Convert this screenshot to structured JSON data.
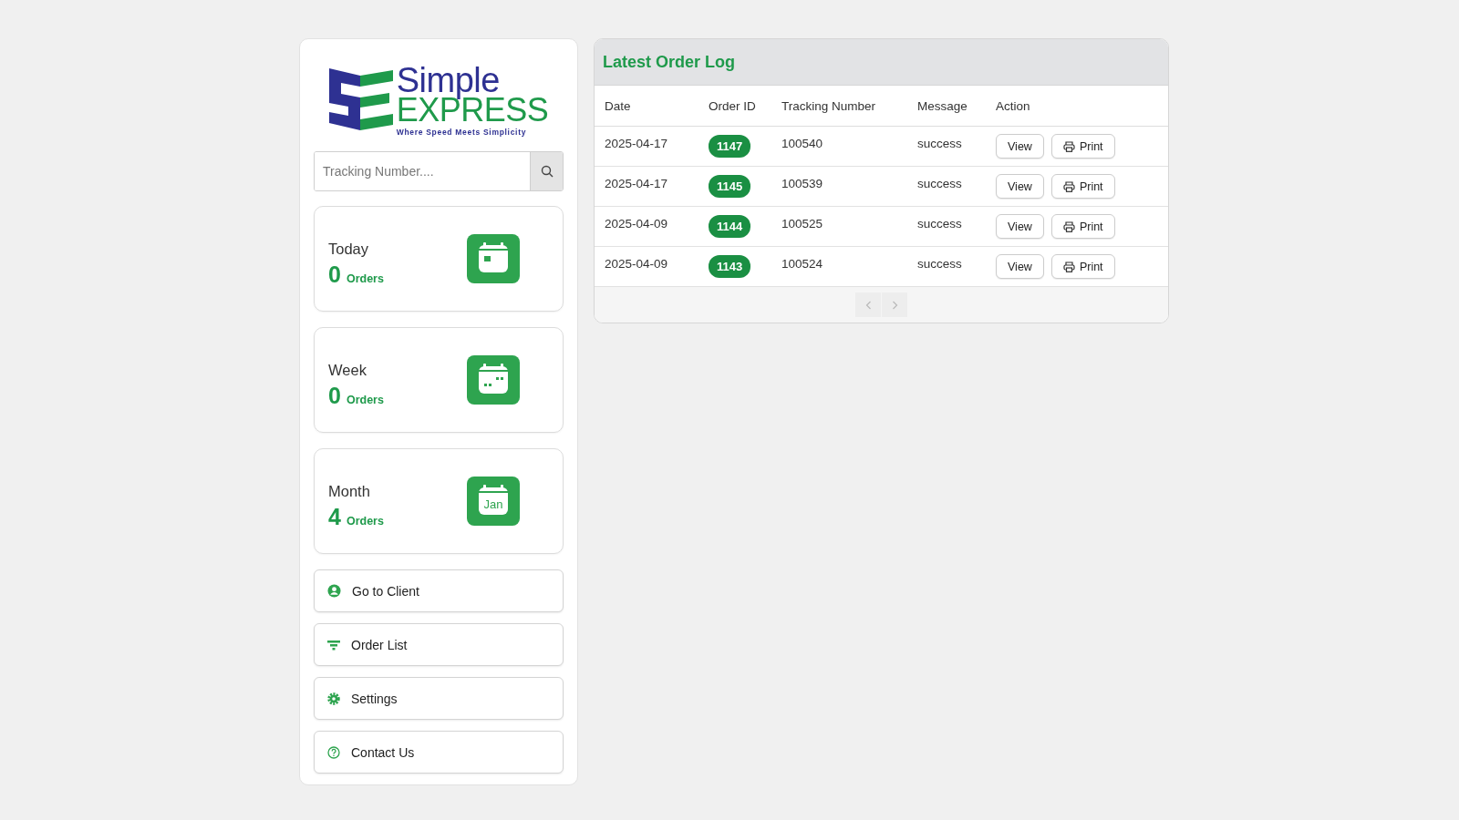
{
  "logo": {
    "word_top": "Simple",
    "word_bottom": "EXPRESS",
    "tagline": "Where Speed Meets Simplicity"
  },
  "search": {
    "placeholder": "Tracking Number...."
  },
  "stats": [
    {
      "kind": "today",
      "label": "Today",
      "count": "0",
      "unit": "Orders"
    },
    {
      "kind": "week",
      "label": "Week",
      "count": "0",
      "unit": "Orders"
    },
    {
      "kind": "month",
      "label": "Month",
      "count": "4",
      "unit": "Orders",
      "icon_text": "Jan"
    }
  ],
  "nav": [
    {
      "kind": "client",
      "label": "Go to Client"
    },
    {
      "kind": "list",
      "label": "Order List"
    },
    {
      "kind": "settings",
      "label": "Settings"
    },
    {
      "kind": "contact",
      "label": "Contact Us"
    }
  ],
  "order_log": {
    "title": "Latest Order Log",
    "columns": [
      "Date",
      "Order ID",
      "Tracking Number",
      "Message",
      "Action"
    ],
    "rows": [
      {
        "date": "2025-04-17",
        "order_id": "1147",
        "tracking": "100540",
        "message": "success",
        "actions": [
          "View",
          "Print"
        ]
      },
      {
        "date": "2025-04-17",
        "order_id": "1145",
        "tracking": "100539",
        "message": "success",
        "actions": [
          "View",
          "Print"
        ]
      },
      {
        "date": "2025-04-09",
        "order_id": "1144",
        "tracking": "100525",
        "message": "success",
        "actions": [
          "View",
          "Print"
        ]
      },
      {
        "date": "2025-04-09",
        "order_id": "1143",
        "tracking": "100524",
        "message": "success",
        "actions": [
          "View",
          "Print"
        ]
      }
    ],
    "pagination": {
      "prev_disabled": true,
      "next_disabled": true
    }
  }
}
